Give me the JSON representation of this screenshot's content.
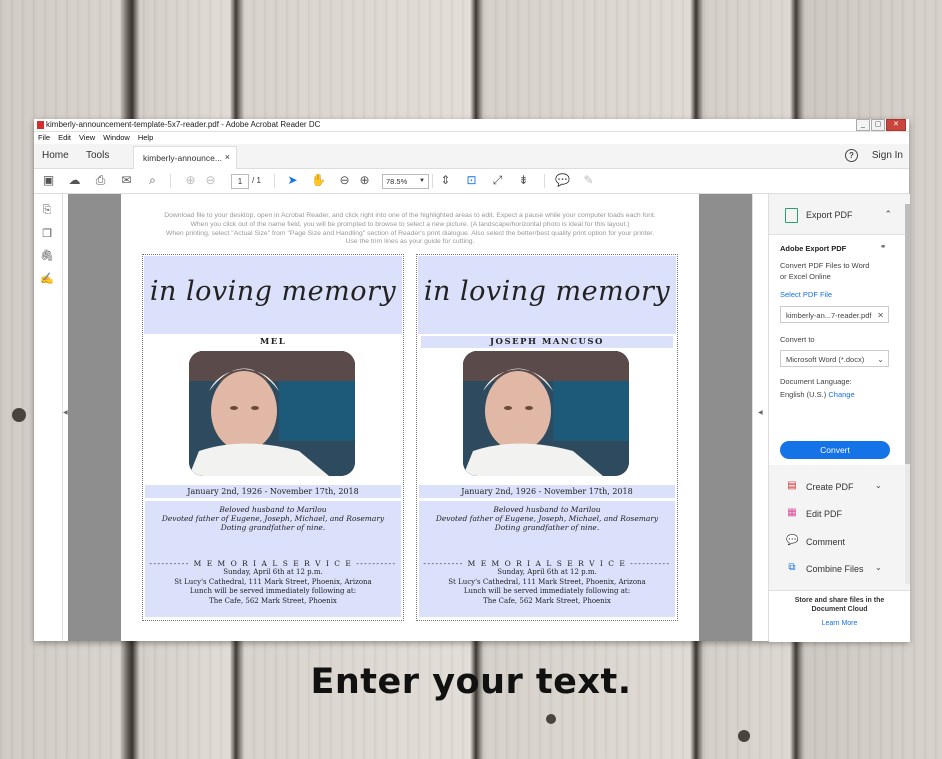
{
  "window": {
    "title": "kimberly-announcement-template-5x7-reader.pdf - Adobe Acrobat Reader DC",
    "controls": [
      "_",
      "▢",
      "✕"
    ]
  },
  "menu": [
    "File",
    "Edit",
    "View",
    "Window",
    "Help"
  ],
  "tabs": {
    "home": "Home",
    "tools": "Tools",
    "document": "kimberly-announce...",
    "close": "×",
    "sign_in": "Sign In",
    "help": "?"
  },
  "toolbar": {
    "page_current": "1",
    "page_total": "/ 1",
    "zoom": "78.5%",
    "icons": [
      "save-icon",
      "upload-icon",
      "print-icon",
      "email-icon",
      "search-icon",
      "prev-page-icon",
      "next-page-icon",
      "select-cursor-icon",
      "hand-icon",
      "zoom-out-icon",
      "zoom-in-icon",
      "fit-width-icon",
      "fit-page-icon",
      "fullscreen-icon",
      "scroll-mode-icon",
      "comment-icon",
      "pen-icon"
    ]
  },
  "left_rail": {
    "icons": [
      "bookmark-edit-icon",
      "pages-icon",
      "attachment-icon",
      "signature-icon"
    ]
  },
  "document": {
    "instructions": [
      "Download file to your desktop, open in Acrobat Reader, and click right into one of the highlighted areas to edit.  Expect a pause while your computer loads each font.",
      "When you click out of the name field, you will be prompted to browse to select a new picture.  (A landscape/horizontal photo is ideal for this layout.)",
      "When printing, select \"Actual Size\" from \"Page Size and Handling\" section of Reader's print dialogue.  Also select the better/best quality print option for your printer.",
      "Use the trim lines as your guide for cutting."
    ],
    "cards": [
      {
        "heading": "in loving memory",
        "name": "MEL",
        "date": "January 2nd, 1926 - November 17th, 2018",
        "tribute": [
          "Beloved husband to Marilou",
          "Devoted father of Eugene, Joseph, Michael, and Rosemary",
          "Doting grandfather of nine."
        ],
        "service_heading": "---------- M E M O R I A L   S E R V I C E ----------",
        "service": [
          "Sunday, April 6th at 12 p.m.",
          "St Lucy's Cathedral, 111 Mark Street, Phoenix, Arizona",
          "Lunch will be served immediately following at:",
          "The Cafe, 562 Mark Street, Phoenix"
        ]
      },
      {
        "heading": "in loving memory",
        "name": "JOSEPH MANCUSO",
        "date": "January 2nd, 1926 - November 17th, 2018",
        "tribute": [
          "Beloved husband to Marilou",
          "Devoted father of Eugene, Joseph, Michael, and Rosemary",
          "Doting grandfather of nine."
        ],
        "service_heading": "---------- M E M O R I A L   S E R V I C E ----------",
        "service": [
          "Sunday, April 6th at 12 p.m.",
          "St Lucy's Cathedral, 111 Mark Street, Phoenix, Arizona",
          "Lunch will be served immediately following at:",
          "The Cafe, 562 Mark Street, Phoenix"
        ]
      }
    ]
  },
  "right_panel": {
    "export_header": "Export PDF",
    "section_title": "Adobe Export PDF",
    "section_desc": [
      "Convert PDF Files to Word",
      "or Excel Online"
    ],
    "select_file_label": "Select PDF File",
    "selected_file": "kimberly-an...7-reader.pdf",
    "convert_to_label": "Convert to",
    "convert_to_value": "Microsoft Word (*.docx)",
    "language_label": "Document Language:",
    "language_value": "English (U.S.)",
    "language_change": "Change",
    "convert_button": "Convert",
    "tools": [
      {
        "label": "Create PDF",
        "icon": "create-pdf-icon",
        "chevron": "⌄"
      },
      {
        "label": "Edit PDF",
        "icon": "edit-pdf-icon",
        "chevron": ""
      },
      {
        "label": "Comment",
        "icon": "comment-icon",
        "chevron": ""
      },
      {
        "label": "Combine Files",
        "icon": "combine-files-icon",
        "chevron": "⌄"
      }
    ],
    "footer_text": [
      "Store and share files in the",
      "Document Cloud"
    ],
    "footer_link": "Learn More"
  },
  "caption": "Enter your text.",
  "colors": {
    "accent": "#1473e6",
    "card_highlight": "#dbe1fb",
    "canvas_gray": "#8e8e8e"
  }
}
